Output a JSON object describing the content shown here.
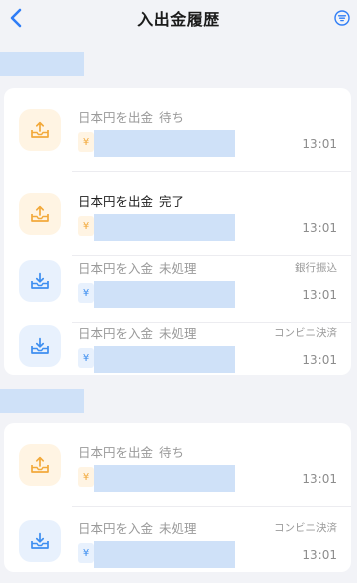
{
  "header": {
    "title": "入出金履歴",
    "back_icon": "chevron-left-icon",
    "filter_icon": "filter-list-icon"
  },
  "colors": {
    "accent": "#2f7df6",
    "withdraw": "#f2a93b",
    "deposit": "#3d8ef0",
    "placeholder": "#cfe1f8"
  },
  "groups": [
    {
      "items": [
        {
          "kind": "out",
          "label": "日本円を出金",
          "status": "待ち",
          "method": "",
          "currency": "¥",
          "time": "13:01",
          "active": false
        },
        {
          "kind": "out",
          "label": "日本円を出金",
          "status": "完了",
          "method": "",
          "currency": "¥",
          "time": "13:01",
          "active": true
        },
        {
          "kind": "in",
          "label": "日本円を入金",
          "status": "未処理",
          "method": "銀行振込",
          "currency": "¥",
          "time": "13:01",
          "active": false
        },
        {
          "kind": "in",
          "label": "日本円を入金",
          "status": "未処理",
          "method": "コンビニ決済",
          "currency": "¥",
          "time": "13:01",
          "active": false
        }
      ]
    },
    {
      "items": [
        {
          "kind": "out",
          "label": "日本円を出金",
          "status": "待ち",
          "method": "",
          "currency": "¥",
          "time": "13:01",
          "active": false
        },
        {
          "kind": "in",
          "label": "日本円を入金",
          "status": "未処理",
          "method": "コンビニ決済",
          "currency": "¥",
          "time": "13:01",
          "active": false
        }
      ]
    }
  ]
}
